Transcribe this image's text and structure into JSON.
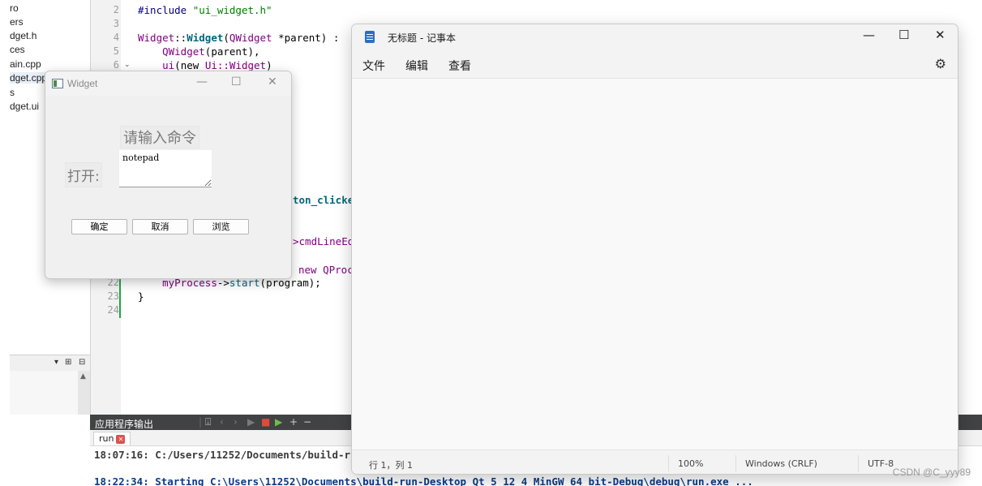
{
  "project_tree": {
    "items": [
      "ro",
      "ers",
      "dget.h",
      "ces",
      "ain.cpp",
      "dget.cpp",
      "s",
      "dget.ui"
    ],
    "panel_tools": [
      "▾",
      "⊞",
      "⊟"
    ]
  },
  "editor": {
    "line_numbers_top": [
      "2",
      "3",
      "4",
      "5",
      "6"
    ],
    "line_numbers_bottom": [
      "22",
      "23",
      "24"
    ],
    "fold_marker": "⌄",
    "lines": {
      "l2_directive": "#include ",
      "l2_string": "\"ui_widget.h\"",
      "l4_class": "Widget",
      "l4_sep": "::",
      "l4_ctor": "Widget",
      "l4_open": "(",
      "l4_type": "QWidget",
      "l4_rest": " *parent) :",
      "l5_indent": "    ",
      "l5_call": "QWidget",
      "l5_rest": "(parent),",
      "l6_indent": "    ",
      "l6_name": "ui",
      "l6_new": "(new ",
      "l6_type": "Ui::Widget",
      "l6_close": ")",
      "frag_clicked": "ton_clicke",
      "frag_cmdline": ">cmdLineEd",
      "frag_new": "new ",
      "frag_qproc": "QProc",
      "l22_indent": "    ",
      "l22_obj": "myProcess",
      "l22_arrow": "->",
      "l22_fn": "start",
      "l22_rest": "(program);",
      "l23": "}"
    }
  },
  "output_panel": {
    "title": "应用程序输出",
    "tab_label": "run",
    "tab_close": "✕",
    "lines": [
      "18:07:16: C:/Users/11252/Documents/build-r",
      "18:22:34: Starting C:\\Users\\11252\\Documents\\build-run-Desktop_Qt_5_12_4_MinGW_64_bit-Debug\\debug\\run.exe ..."
    ],
    "toolbar_icons": {
      "attach": "⍗",
      "prev": "‹",
      "next": "›",
      "run": "▶",
      "stop": "■",
      "debug": "▶",
      "add": "+",
      "remove": "−"
    }
  },
  "widget_window": {
    "title": "Widget",
    "controls": {
      "minimize": "—",
      "maximize": "☐",
      "close": "✕"
    },
    "prompt_label": "请输入命令",
    "open_label": "打开:",
    "command_value": "notepad",
    "buttons": {
      "ok": "确定",
      "cancel": "取消",
      "browse": "浏览"
    }
  },
  "notepad_window": {
    "title": "无标题 - 记事本",
    "controls": {
      "minimize": "—",
      "maximize": "☐",
      "close": "✕"
    },
    "menu": [
      "文件",
      "编辑",
      "查看"
    ],
    "settings_icon": "⚙",
    "status": {
      "position": "行 1，列 1",
      "zoom": "100%",
      "line_ending": "Windows (CRLF)",
      "encoding": "UTF-8"
    }
  },
  "watermark": "CSDN @C_yyy89"
}
